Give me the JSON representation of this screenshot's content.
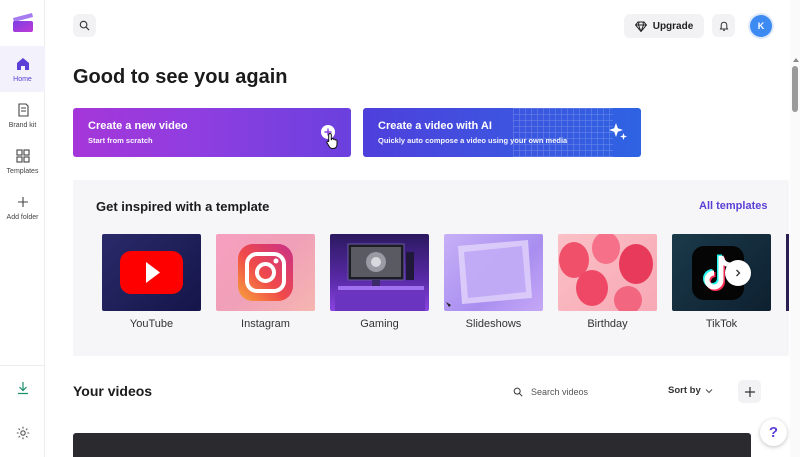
{
  "sidebar": {
    "items": [
      {
        "label": "Home",
        "icon": "home-icon"
      },
      {
        "label": "Brand kit",
        "icon": "brand-kit-icon"
      },
      {
        "label": "Templates",
        "icon": "templates-icon"
      },
      {
        "label": "Add folder",
        "icon": "plus-icon"
      }
    ],
    "bottom_icons": [
      "download-icon",
      "gear-icon"
    ]
  },
  "header": {
    "upgrade_label": "Upgrade",
    "avatar_initial": "K"
  },
  "main": {
    "title": "Good to see you again",
    "create_new": {
      "title": "Create a new video",
      "subtitle": "Start from scratch"
    },
    "create_ai": {
      "title": "Create a video with AI",
      "subtitle": "Quickly auto compose a video using your own media"
    }
  },
  "templates": {
    "title": "Get inspired with a template",
    "all_label": "All templates",
    "items": [
      {
        "name": "YouTube"
      },
      {
        "name": "Instagram"
      },
      {
        "name": "Gaming"
      },
      {
        "name": "Slideshows"
      },
      {
        "name": "Birthday"
      },
      {
        "name": "TikTok"
      }
    ]
  },
  "videos": {
    "title": "Your videos",
    "search_placeholder": "Search videos",
    "sort_label": "Sort by"
  },
  "help": {
    "label": "?"
  },
  "colors": {
    "accent": "#5b3fd6",
    "avatar": "#3d8bf2",
    "youtube_red": "#ff0000"
  }
}
